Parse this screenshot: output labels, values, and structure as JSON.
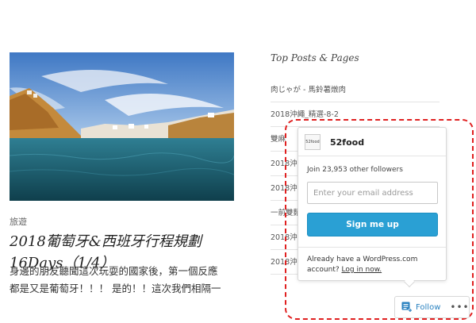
{
  "post": {
    "category": "旅遊",
    "title_line1": "2018葡萄牙&西班牙行程規劃",
    "title_line2": "16Days（1/4）",
    "excerpt_line1": "身邊的朋友聽聞這次玩耍的國家後，第一個反應",
    "excerpt_line2": "都是又是葡萄牙！！！ 是的！！這次我們相隔一"
  },
  "widget": {
    "title": "Top Posts & Pages",
    "items": [
      "肉じゃが - 馬鈴薯燉肉",
      "2018沖繩_精選-8-2",
      "雙麻",
      "2018沖",
      "2018沖",
      "一前雙麵",
      "2018沖",
      "2018沖繩_精選-10-2"
    ]
  },
  "popover": {
    "site_name": "52food",
    "site_icon_text": "52food",
    "followers_text": "Join 23,953 other followers",
    "email_placeholder": "Enter your email address",
    "signup_label": "Sign me up",
    "already_text": "Already have a WordPress.com account?",
    "login_label": "Log in now."
  },
  "follow_bar": {
    "follow_label": "Follow",
    "more_label": "•••"
  },
  "colors": {
    "accent": "#2aa0d4",
    "annotation": "#e02020",
    "link": "#2a82c0"
  }
}
